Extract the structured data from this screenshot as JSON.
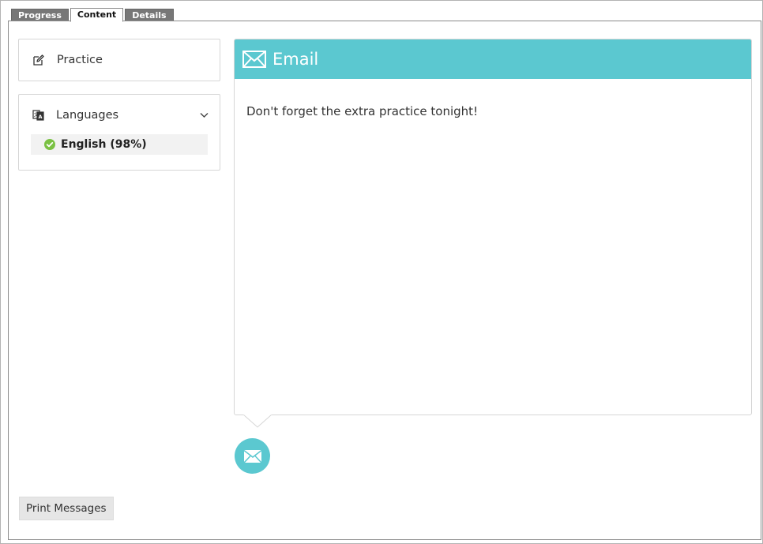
{
  "tabs": [
    {
      "label": "Progress",
      "active": false
    },
    {
      "label": "Content",
      "active": true
    },
    {
      "label": "Details",
      "active": false
    }
  ],
  "sidebar": {
    "practice": {
      "label": "Practice",
      "icon": "edit-icon"
    },
    "languages": {
      "label": "Languages",
      "icon": "language-icon",
      "expanded": true,
      "items": [
        {
          "label": "English (98%)",
          "status": "complete",
          "icon": "check-circle-icon"
        }
      ]
    }
  },
  "message": {
    "type_label": "Email",
    "icon": "envelope-icon",
    "body": "Don't forget the extra practice tonight!"
  },
  "footer": {
    "print_label": "Print Messages"
  },
  "colors": {
    "accent": "#5bc8d0",
    "check": "#7ac143",
    "tab_inactive": "#777777"
  }
}
